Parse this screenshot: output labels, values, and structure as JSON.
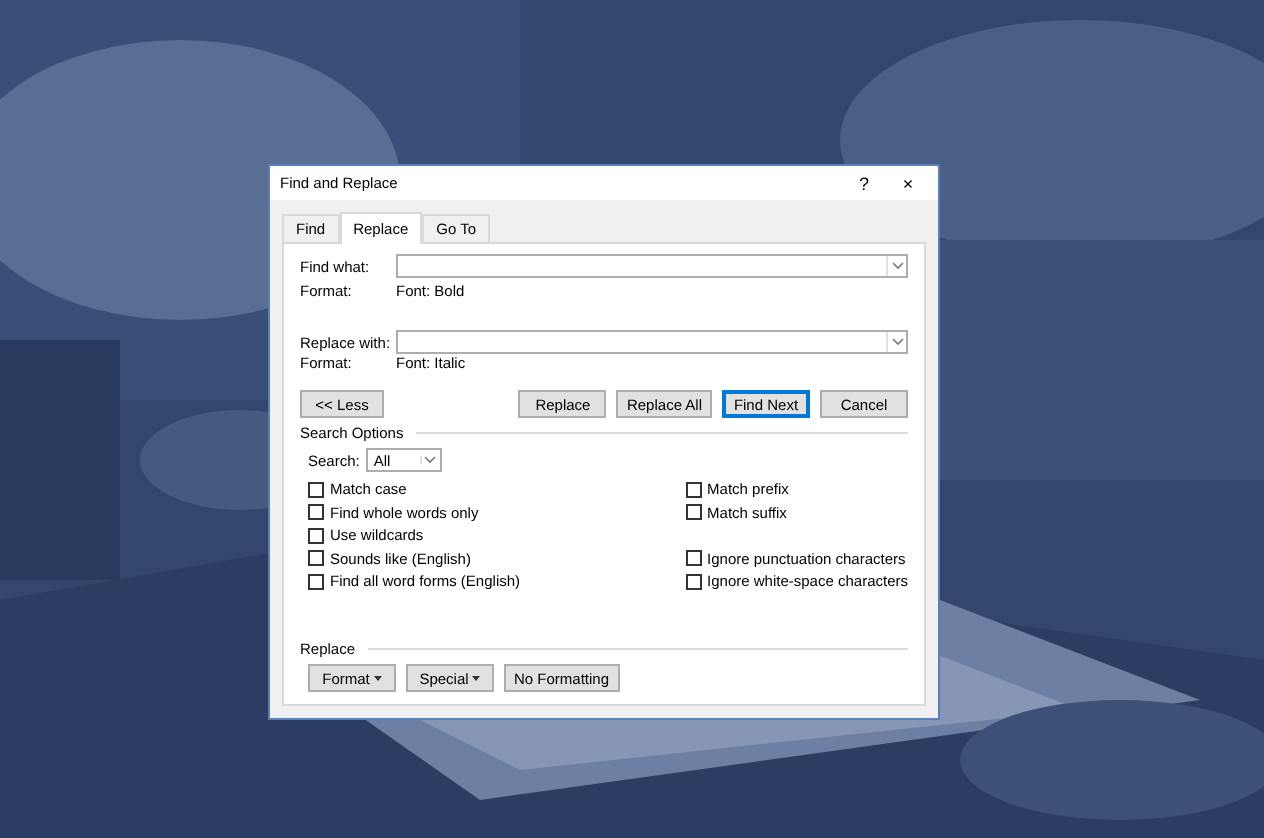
{
  "window": {
    "title": "Find and Replace",
    "help": "?",
    "close": "×"
  },
  "tabs": [
    {
      "label": "Find",
      "selected": false
    },
    {
      "label": "Replace",
      "selected": true
    },
    {
      "label": "Go To",
      "selected": false
    }
  ],
  "find": {
    "label": "Find what:",
    "format_label": "Format:",
    "format": "Font: Bold"
  },
  "replace": {
    "label": "Replace with:",
    "format_label": "Format:",
    "format": "Font: Italic"
  },
  "less_button": "<< Less",
  "action_buttons": [
    {
      "label": "Replace",
      "default": false
    },
    {
      "label": "Replace All",
      "default": false
    },
    {
      "label": "Find Next",
      "default": true
    },
    {
      "label": "Cancel",
      "default": false
    }
  ],
  "search_options": {
    "heading": "Search Options",
    "search_label": "Search:",
    "search_value": "All",
    "left": [
      {
        "label": "Match case",
        "checked": false
      },
      {
        "label": "Find whole words only",
        "checked": false
      },
      {
        "label": "Use wildcards",
        "checked": false
      },
      {
        "label": "Sounds like (English)",
        "checked": false
      },
      {
        "label": "Find all word forms (English)",
        "checked": false
      }
    ],
    "right": [
      {
        "label": "Match prefix",
        "checked": false
      },
      {
        "label": "Match suffix",
        "checked": false
      },
      {
        "label": "Ignore punctuation characters",
        "checked": false
      },
      {
        "label": "Ignore white-space characters",
        "checked": false
      }
    ]
  },
  "replace_section": {
    "heading": "Replace",
    "buttons": [
      {
        "label": "Format",
        "kind": "menu"
      },
      {
        "label": "Special",
        "kind": "menu"
      },
      {
        "label": "No Formatting",
        "kind": "plain"
      }
    ]
  }
}
